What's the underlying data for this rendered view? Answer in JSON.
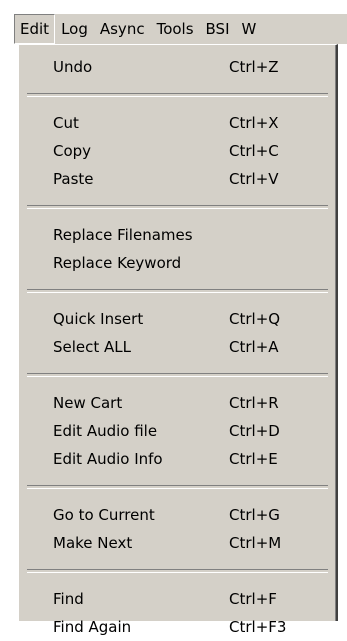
{
  "menubar": {
    "items": [
      "Edit",
      "Log",
      "Async",
      "Tools",
      "BSI",
      "W"
    ]
  },
  "edit_menu": {
    "groups": [
      [
        {
          "label": "Undo",
          "shortcut": "Ctrl+Z"
        }
      ],
      [
        {
          "label": "Cut",
          "shortcut": "Ctrl+X"
        },
        {
          "label": "Copy",
          "shortcut": "Ctrl+C"
        },
        {
          "label": "Paste",
          "shortcut": "Ctrl+V"
        }
      ],
      [
        {
          "label": "Replace Filenames",
          "shortcut": ""
        },
        {
          "label": "Replace Keyword",
          "shortcut": ""
        }
      ],
      [
        {
          "label": "Quick Insert",
          "shortcut": "Ctrl+Q"
        },
        {
          "label": "Select ALL",
          "shortcut": "Ctrl+A"
        }
      ],
      [
        {
          "label": "New Cart",
          "shortcut": "Ctrl+R"
        },
        {
          "label": "Edit Audio file",
          "shortcut": "Ctrl+D"
        },
        {
          "label": "Edit Audio Info",
          "shortcut": "Ctrl+E"
        }
      ],
      [
        {
          "label": "Go to Current",
          "shortcut": "Ctrl+G"
        },
        {
          "label": "Make Next",
          "shortcut": "Ctrl+M"
        }
      ],
      [
        {
          "label": "Find",
          "shortcut": "Ctrl+F"
        },
        {
          "label": "Find Again",
          "shortcut": "Ctrl+F3"
        }
      ]
    ]
  }
}
